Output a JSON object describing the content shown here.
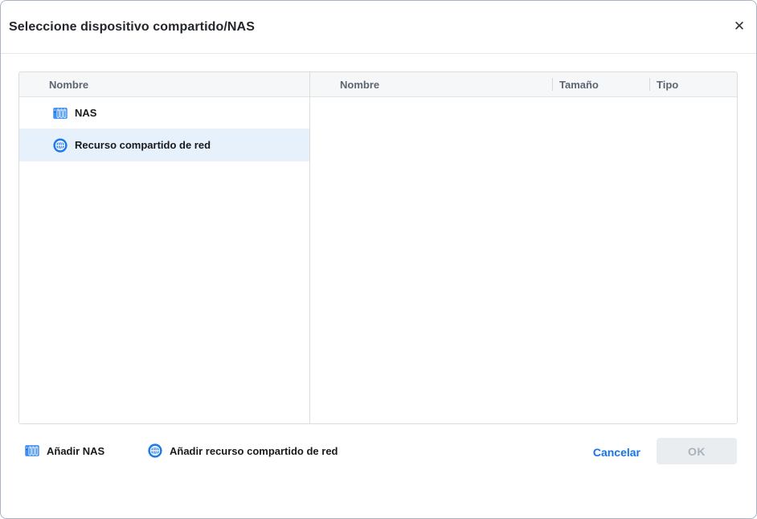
{
  "dialog": {
    "title": "Seleccione dispositivo compartido/NAS",
    "close_glyph": "✕"
  },
  "left_panel": {
    "header": "Nombre",
    "items": [
      {
        "label": "NAS",
        "icon": "nas-icon",
        "selected": false
      },
      {
        "label": "Recurso compartido de red",
        "icon": "globe-icon",
        "selected": true
      }
    ]
  },
  "right_panel": {
    "columns": [
      "Nombre",
      "Tamaño",
      "Tipo"
    ],
    "rows": []
  },
  "footer": {
    "add_nas_label": "Añadir NAS",
    "add_share_label": "Añadir recurso compartido de red",
    "cancel_label": "Cancelar",
    "ok_label": "OK",
    "ok_enabled": false
  },
  "colors": {
    "accent_blue": "#1b7af0",
    "link_blue": "#1874e8",
    "selected_row_bg": "#e7f1fb",
    "disabled_button_bg": "#e9edf0",
    "disabled_button_text": "#a9b3bd",
    "header_bg": "#f6f7f8",
    "border_gray": "#dcdcdc"
  }
}
